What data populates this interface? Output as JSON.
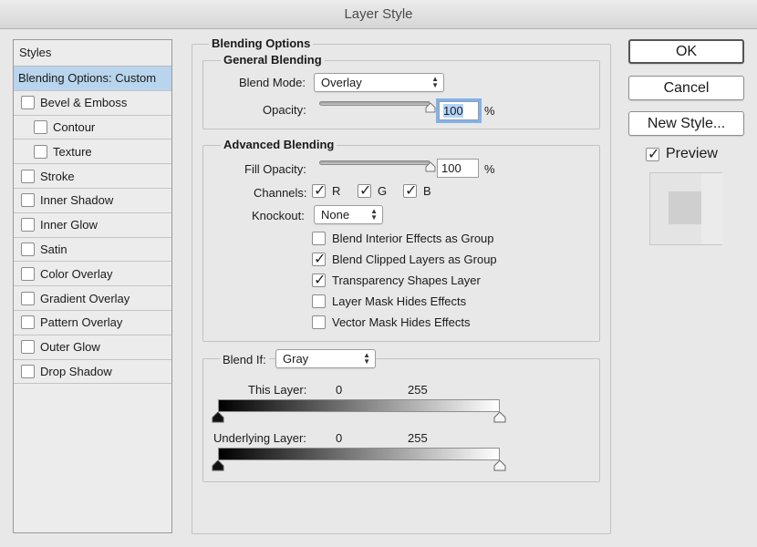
{
  "window": {
    "title": "Layer Style"
  },
  "styles_panel": {
    "header": "Styles",
    "items": [
      {
        "label": "Blending Options: Custom",
        "selected": true,
        "has_checkbox": false,
        "checked": false
      },
      {
        "label": "Bevel & Emboss",
        "has_checkbox": true,
        "checked": false
      },
      {
        "label": "Contour",
        "has_checkbox": true,
        "checked": false,
        "sub": true
      },
      {
        "label": "Texture",
        "has_checkbox": true,
        "checked": false,
        "sub": true
      },
      {
        "label": "Stroke",
        "has_checkbox": true,
        "checked": false
      },
      {
        "label": "Inner Shadow",
        "has_checkbox": true,
        "checked": false
      },
      {
        "label": "Inner Glow",
        "has_checkbox": true,
        "checked": false
      },
      {
        "label": "Satin",
        "has_checkbox": true,
        "checked": false
      },
      {
        "label": "Color Overlay",
        "has_checkbox": true,
        "checked": false
      },
      {
        "label": "Gradient Overlay",
        "has_checkbox": true,
        "checked": false
      },
      {
        "label": "Pattern Overlay",
        "has_checkbox": true,
        "checked": false
      },
      {
        "label": "Outer Glow",
        "has_checkbox": true,
        "checked": false
      },
      {
        "label": "Drop Shadow",
        "has_checkbox": true,
        "checked": false
      }
    ]
  },
  "blending_options": {
    "title": "Blending Options",
    "general": {
      "title": "General Blending",
      "blend_mode_label": "Blend Mode:",
      "blend_mode_value": "Overlay",
      "opacity_label": "Opacity:",
      "opacity_value": "100",
      "opacity_unit": "%",
      "opacity_level": 1.0
    },
    "advanced": {
      "title": "Advanced Blending",
      "fill_opacity_label": "Fill Opacity:",
      "fill_opacity_value": "100",
      "fill_opacity_unit": "%",
      "fill_opacity_level": 1.0,
      "channels_label": "Channels:",
      "channels": [
        {
          "label": "R",
          "checked": true
        },
        {
          "label": "G",
          "checked": true
        },
        {
          "label": "B",
          "checked": true
        }
      ],
      "knockout_label": "Knockout:",
      "knockout_value": "None",
      "options": [
        {
          "label": "Blend Interior Effects as Group",
          "checked": false
        },
        {
          "label": "Blend Clipped Layers as Group",
          "checked": true
        },
        {
          "label": "Transparency Shapes Layer",
          "checked": true
        },
        {
          "label": "Layer Mask Hides Effects",
          "checked": false
        },
        {
          "label": "Vector Mask Hides Effects",
          "checked": false
        }
      ]
    },
    "blend_if": {
      "label": "Blend If:",
      "value": "Gray",
      "this_layer_label": "This Layer:",
      "this_layer_min": "0",
      "this_layer_max": "255",
      "underlying_label": "Underlying Layer:",
      "underlying_min": "0",
      "underlying_max": "255"
    }
  },
  "buttons": {
    "ok": "OK",
    "cancel": "Cancel",
    "new_style": "New Style...",
    "preview_label": "Preview",
    "preview_checked": true
  },
  "colors": {
    "selection": "#b9d5ee",
    "focus_ring": "#7fb2ea",
    "background": "#e8e8e8"
  }
}
